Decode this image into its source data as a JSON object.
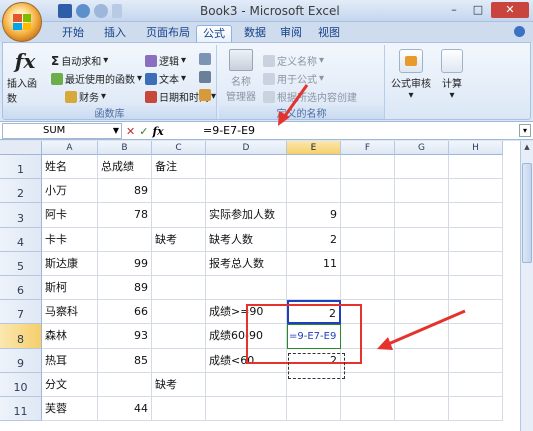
{
  "window": {
    "title": "Book3 - Microsoft Excel",
    "controls": [
      "–",
      "□",
      "✕"
    ]
  },
  "ribbon_tabs": [
    "开始",
    "插入",
    "页面布局",
    "公式",
    "数据",
    "审阅",
    "视图"
  ],
  "active_tab": "公式",
  "ribbon": {
    "insert_function": "插入函数",
    "autosum": "自动求和",
    "recent": "最近使用的函数",
    "finance": "财务",
    "logic": "逻辑",
    "text": "文本",
    "datetime": "日期和时间",
    "library_label": "函数库",
    "name_manager_line1": "名称",
    "name_manager_line2": "管理器",
    "define_name": "定义名称",
    "use_in_formula": "用于公式",
    "create_from_selection": "根据所选内容创建",
    "defined_names_label": "定义的名称",
    "formula_audit": "公式审核",
    "calculate": "计算"
  },
  "formula_bar": {
    "name_box": "SUM",
    "cancel": "✕",
    "enter": "✓",
    "fx": "fx",
    "formula": "=9-E7-E9"
  },
  "columns": [
    "A",
    "B",
    "C",
    "D",
    "E",
    "F",
    "G",
    "H"
  ],
  "selected_column": "E",
  "selected_row": "8",
  "rows": [
    {
      "n": "1",
      "A": "姓名",
      "B": "总成绩",
      "C": "备注",
      "D": "",
      "E": ""
    },
    {
      "n": "2",
      "A": "小万",
      "B": "89",
      "C": "",
      "D": "",
      "E": ""
    },
    {
      "n": "3",
      "A": "阿卡",
      "B": "78",
      "C": "",
      "D": "实际参加人数",
      "E": "9"
    },
    {
      "n": "4",
      "A": "卡卡",
      "B": "",
      "C": "缺考",
      "D": "缺考人数",
      "E": "2"
    },
    {
      "n": "5",
      "A": "斯达康",
      "B": "99",
      "C": "",
      "D": "报考总人数",
      "E": "11"
    },
    {
      "n": "6",
      "A": "斯柯",
      "B": "89",
      "C": "",
      "D": "",
      "E": ""
    },
    {
      "n": "7",
      "A": "马察科",
      "B": "66",
      "C": "",
      "D": "成绩>=90",
      "E": "2"
    },
    {
      "n": "8",
      "A": "森林",
      "B": "93",
      "C": "",
      "D": "成绩60-90",
      "E": "=9-E7-E9"
    },
    {
      "n": "9",
      "A": "热耳",
      "B": "85",
      "C": "",
      "D": "成绩<60",
      "E": "2"
    },
    {
      "n": "10",
      "A": "分文",
      "B": "",
      "C": "缺考",
      "D": "",
      "E": ""
    },
    {
      "n": "11",
      "A": "芙蓉",
      "B": "44",
      "C": "",
      "D": "",
      "E": ""
    }
  ],
  "colors": {
    "accent_red": "#e5322d",
    "formula_blue": "#1f3fbf",
    "formula_green": "#2a8a2a",
    "selected_header": "#f6cf6a"
  }
}
